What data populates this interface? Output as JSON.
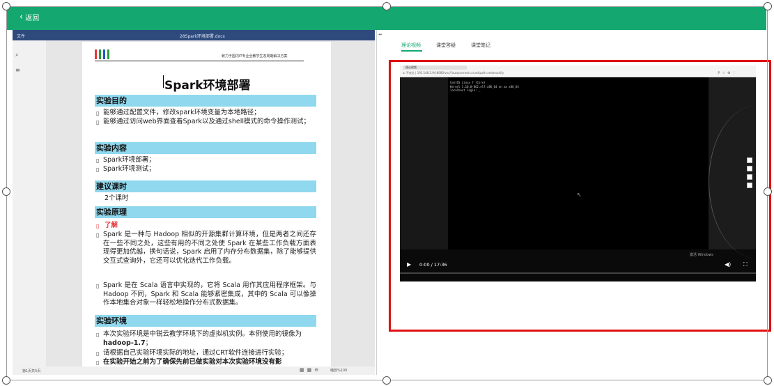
{
  "topbar": {
    "back_label": "返回",
    "back_icon": "chevron-left-icon",
    "color": "#14a870"
  },
  "doc": {
    "file_menu": "文件",
    "filename": "28Spark环境部署.docx",
    "logo_tagline": "致力于国内IT专业全教学生态周期解决方案",
    "title": "Spark环境部署",
    "sections": [
      {
        "heading": "实验目的",
        "items": [
          "能够通过配置文件，修改spark环境变量为本地路径；",
          "能够通过访问web界面查看Spark以及通过shell模式的命令操作测试；"
        ]
      },
      {
        "heading": "实验内容",
        "items": [
          "Spark环境部署；",
          "Spark环境测试；"
        ]
      },
      {
        "heading": "建议课时",
        "items": [
          "2个课时"
        ]
      },
      {
        "heading": "实验原理",
        "understand": "了解",
        "items": [
          "Spark 是一种与 Hadoop 相似的开源集群计算环境，但是两者之间还存在一些不同之处，这些有用的不同之处使 Spark 在某些工作负载方面表现得更加优越，换句话说，Spark 启用了内存分布数据集，除了能够提供交互式查询外，它还可以优化迭代工作负载。",
          "Spark 是在 Scala 语言中实现的，它将 Scala 用作其应用程序框架。与 Hadoop 不同，Spark 和 Scala 能够紧密集成，其中的 Scala 可以像操作本地集合对象一样轻松地操作分布式数据集。"
        ]
      },
      {
        "heading": "实验环境",
        "items": [
          "本次实验环境是中锐云教学环境下的虚拟机实例。本例使用的镜像为",
          "hadoop-1.7",
          "；",
          "请根据自己实验环境实际的地址，通过CRT软件连接进行实验；",
          "在实验开始之前为了确保先前已做实验对本次实验环境没有影"
        ]
      }
    ],
    "status_page": "第1页共5页",
    "status_zoom": "缩放%100"
  },
  "right_panel": {
    "tabs": [
      "理论视频",
      "课堂答疑",
      "课堂笔记"
    ],
    "active_tab": 0,
    "video": {
      "time": "0:00 / 17:36",
      "terminal_lines": [
        "CentOS Linux 7 (Core)",
        "Kernel 3.10.0-862.el7.x86_64 on an x86_64",
        "",
        "localhost login: _"
      ],
      "browser_tab": "理论视频",
      "address": "① 不安全 | 192.168.2.94:8080/vnc/?autoconnect=true&path=websockify",
      "watermark": "激活 Windows"
    }
  },
  "colors": {
    "highlight_box": "#e01010",
    "section_bg": "#8fd8ee"
  }
}
